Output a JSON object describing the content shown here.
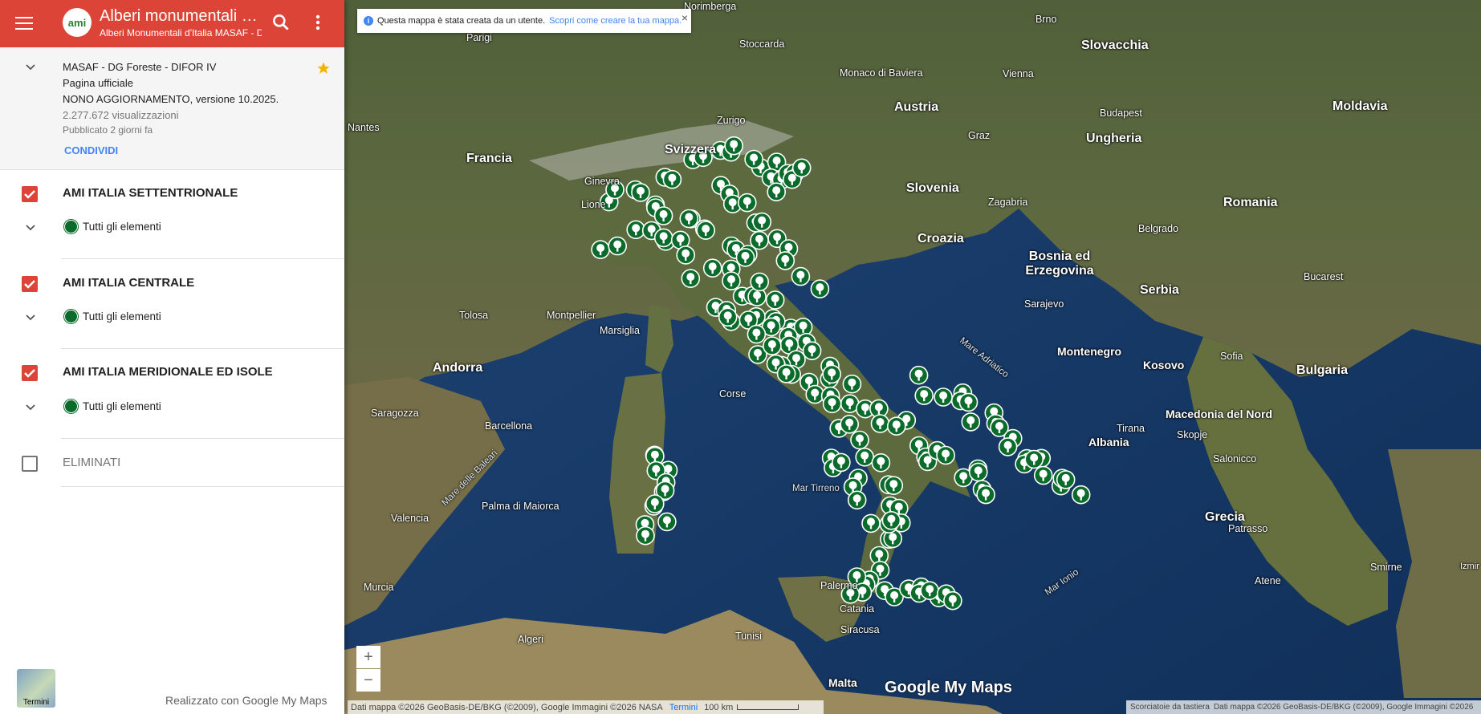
{
  "header": {
    "title": "Alberi monumentali d'...",
    "subtitle": "Alberi Monumentali d'Italia MASAF - D",
    "logo_text": "ami",
    "accent_color": "#db4437"
  },
  "info": {
    "owner": "MASAF - DG Foreste - DIFOR IV",
    "page_type": "Pagina ufficiale",
    "update": "NONO AGGIORNAMENTO, versione 10.2025.",
    "views": "2.277.672 visualizzazioni",
    "published": "Pubblicato 2 giorni fa",
    "share_label": "CONDIVIDI"
  },
  "layers": [
    {
      "title": "AMI ITALIA SETTENTRIONALE",
      "checked": true,
      "item": "Tutti gli elementi"
    },
    {
      "title": "AMI ITALIA CENTRALE",
      "checked": true,
      "item": "Tutti gli elementi"
    },
    {
      "title": "AMI ITALIA MERIDIONALE ED ISOLE",
      "checked": true,
      "item": "Tutti gli elementi"
    },
    {
      "title": "ELIMINATI",
      "checked": false
    }
  ],
  "footer": {
    "thumb_label": "Termini",
    "built_with": "Realizzato con Google My Maps"
  },
  "map": {
    "notice_text": "Questa mappa è stata creata da un utente.",
    "notice_link": "Scopri come creare la tua mappa.",
    "brand": "Google My Maps",
    "attribution_left": "Dati mappa ©2026 GeoBasis-DE/BKG (©2009), Google Immagini ©2026 NASA",
    "terms": "Termini",
    "scale": "100 km",
    "shortcuts": "Scorciatoie da tastiera",
    "attribution_right": "Dati mappa ©2026 GeoBasis-DE/BKG (©2009), Google Immagini ©2026",
    "marker_color": "#0b6b2a",
    "labels": {
      "countries": [
        "Svizzera",
        "Francia",
        "Austria",
        "Slovenia",
        "Croazia",
        "Ungheria",
        "Romania",
        "Slovacchia",
        "Moldavia",
        "Bosnia ed Erzegovina",
        "Serbia",
        "Montenegro",
        "Kosovo",
        "Andorra",
        "Bulgaria",
        "Albania",
        "Macedonia del Nord",
        "Grecia",
        "Malta"
      ],
      "cities": [
        "Norimberga",
        "Stoccarda",
        "Parigi",
        "Monaco di Baviera",
        "Zurigo",
        "Ginevra",
        "Lione",
        "Marsiglia",
        "Tolosa",
        "Montpellier",
        "Barcellona",
        "Saragozza",
        "Valencia",
        "Palma di Maiorca",
        "Murcia",
        "Algeri",
        "Tunisi",
        "Vienna",
        "Brno",
        "Zagabria",
        "Sarajevo",
        "Budapest",
        "Belgrado",
        "Bucarest",
        "Sofia",
        "Tirana",
        "Skopje",
        "Atene",
        "Salonicco",
        "Palermo",
        "Catania",
        "Siracusa",
        "Nantes",
        "Graz",
        "Corse",
        "Smirne",
        "Patrasso",
        "Izmir"
      ],
      "seas": [
        "Mar Tirreno",
        "Mare Adriatico",
        "Mar Ionio",
        "Mare delle Baleari"
      ]
    }
  }
}
